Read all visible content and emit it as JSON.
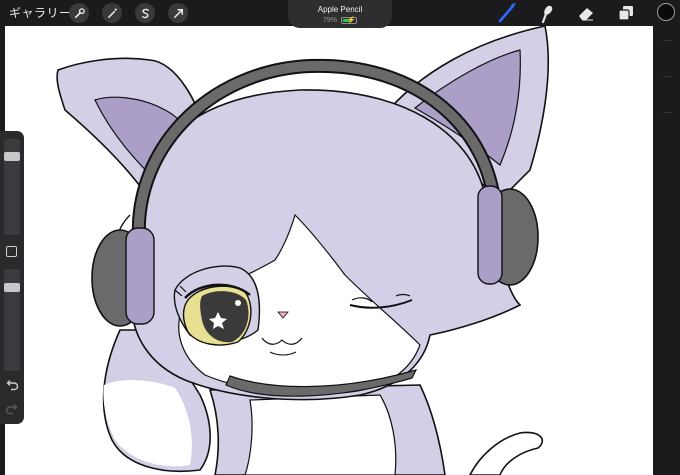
{
  "app": {
    "gallery_label": "ギャラリー",
    "toolbar_icons": [
      "wrench-icon",
      "magic-wand-icon",
      "selection-s-icon",
      "transform-arrow-icon"
    ],
    "right_tools": [
      "brush-icon",
      "smudge-icon",
      "eraser-icon",
      "layers-icon",
      "color-well"
    ],
    "accent_color": "#2f6bff"
  },
  "device": {
    "name": "Apple Pencil",
    "battery_percent": "79%",
    "battery_level": 0.79,
    "battery_color": "#39c24a"
  },
  "sidebar": {
    "brush_size_level": 0.15,
    "opacity_level": 0.15,
    "controls": [
      "undo-icon",
      "redo-icon"
    ]
  },
  "artwork": {
    "fill_color": "#d3cfe6",
    "inner_ear_color": "#ab9ec7",
    "headphone_color": "#6a6a6a",
    "eye_color": "#e8df90",
    "line_color": "#111111"
  }
}
